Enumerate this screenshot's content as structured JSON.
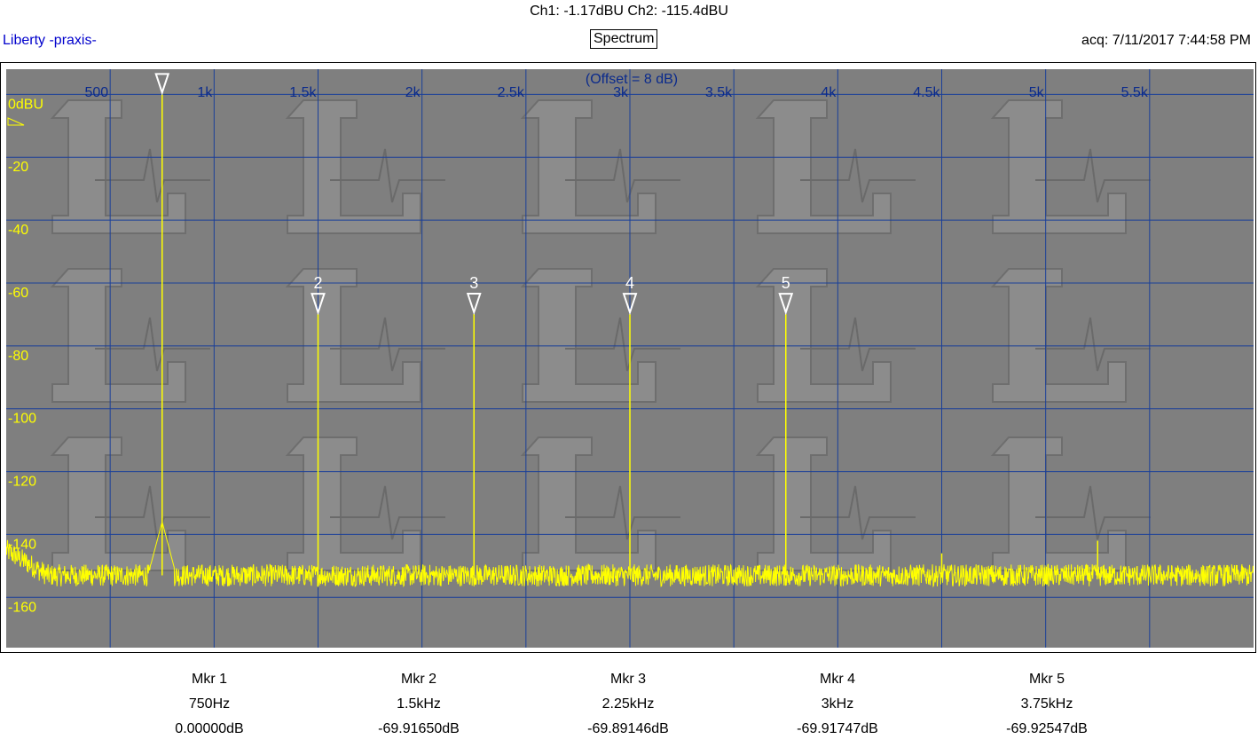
{
  "header": {
    "readout": "Ch1: -1.17dBU  Ch2: -115.4dBU",
    "app_name": "Liberty -praxis-",
    "mode_label": "Spectrum",
    "acq_label": "acq: 7/11/2017 7:44:58 PM"
  },
  "colors": {
    "plot_bg": "#7f7f7f",
    "grid": "#1a3f99",
    "trace": "#ffff00",
    "freq_labels": "#0a2a8c",
    "level_labels": "#ffff00",
    "marker": "#ffffff"
  },
  "chart_data": {
    "type": "line",
    "title": "",
    "annotation": "(Offset = 8 dB)",
    "x_ticks": [
      {
        "value": 500,
        "label": "500"
      },
      {
        "value": 1000,
        "label": "1k"
      },
      {
        "value": 1500,
        "label": "1.5k"
      },
      {
        "value": 2000,
        "label": "2k"
      },
      {
        "value": 2500,
        "label": "2.5k"
      },
      {
        "value": 3000,
        "label": "3k"
      },
      {
        "value": 3500,
        "label": "3.5k"
      },
      {
        "value": 4000,
        "label": "4k"
      },
      {
        "value": 4500,
        "label": "4.5k"
      },
      {
        "value": 5000,
        "label": "5k"
      },
      {
        "value": 5500,
        "label": "5.5k"
      }
    ],
    "y_ticks": [
      {
        "value": 0,
        "label": "0dBU"
      },
      {
        "value": -20,
        "label": "-20"
      },
      {
        "value": -40,
        "label": "-40"
      },
      {
        "value": -60,
        "label": "-60"
      },
      {
        "value": -80,
        "label": "-80"
      },
      {
        "value": -100,
        "label": "-100"
      },
      {
        "value": -120,
        "label": "-120"
      },
      {
        "value": -140,
        "label": "-140"
      },
      {
        "value": -160,
        "label": "-160"
      }
    ],
    "xlim": [
      0,
      6000
    ],
    "ylim": [
      -176,
      8
    ],
    "noise_floor": -153,
    "peaks": [
      {
        "x": 750,
        "y": 0
      },
      {
        "x": 1500,
        "y": -69.9
      },
      {
        "x": 2250,
        "y": -69.9
      },
      {
        "x": 3000,
        "y": -69.9
      },
      {
        "x": 3750,
        "y": -69.9
      },
      {
        "x": 4500,
        "y": -146
      },
      {
        "x": 5250,
        "y": -142
      }
    ],
    "markers": [
      {
        "id": "1",
        "label": "Mkr 1",
        "freq": "750Hz",
        "level": "0.00000dB",
        "x": 750,
        "y": 0
      },
      {
        "id": "2",
        "label": "Mkr 2",
        "freq": "1.5kHz",
        "level": "-69.91650dB",
        "x": 1500,
        "y": -69.9165
      },
      {
        "id": "3",
        "label": "Mkr 3",
        "freq": "2.25kHz",
        "level": "-69.89146dB",
        "x": 2250,
        "y": -69.89146
      },
      {
        "id": "4",
        "label": "Mkr 4",
        "freq": "3kHz",
        "level": "-69.91747dB",
        "x": 3000,
        "y": -69.91747
      },
      {
        "id": "5",
        "label": "Mkr 5",
        "freq": "3.75kHz",
        "level": "-69.92547dB",
        "x": 3750,
        "y": -69.92547
      }
    ]
  }
}
